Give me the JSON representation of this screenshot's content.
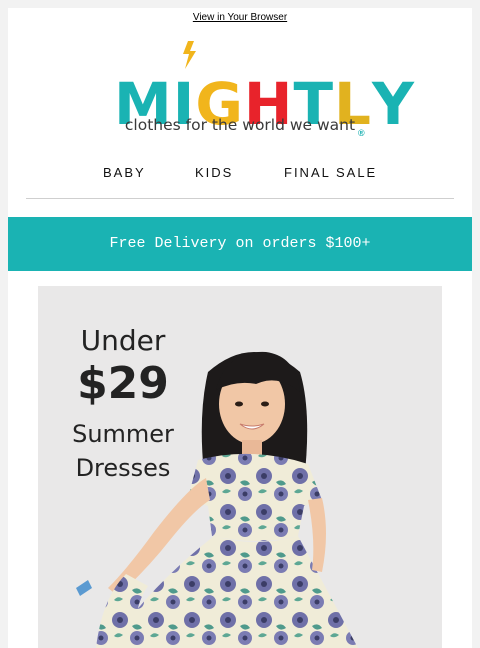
{
  "header": {
    "view_link": "View in Your Browser",
    "logo_letters": [
      "M",
      "I",
      "G",
      "H",
      "T",
      "L",
      "Y"
    ],
    "logo_colors": [
      "#1ab3b3",
      "#1ab3b3",
      "#f1b51c",
      "#e8232b",
      "#1ab3b3",
      "#e1b21f",
      "#1ab3b3"
    ],
    "registered": "®",
    "tagline": "clothes for the world we want"
  },
  "nav": {
    "items": [
      "BABY",
      "KIDS",
      "FINAL SALE"
    ]
  },
  "banner": {
    "text": "Free Delivery on orders $100+"
  },
  "hero": {
    "line1": "Under",
    "price": "$29",
    "line3": "Summer",
    "line4": "Dresses"
  },
  "colors": {
    "accent": "#1ab3b3",
    "bolt": "#f1b51c"
  }
}
